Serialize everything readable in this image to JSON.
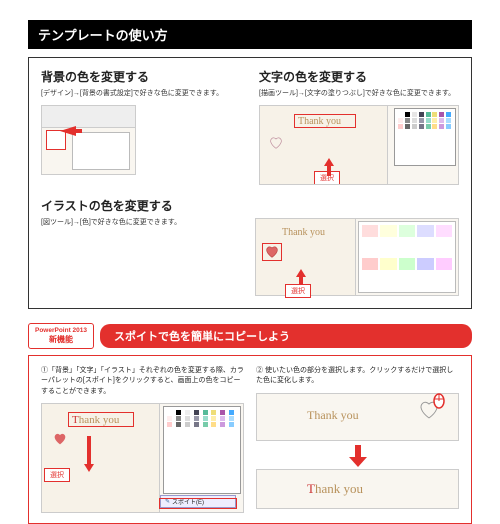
{
  "header": "テンプレートの使い方",
  "sec1": {
    "title": "背景の色を変更する",
    "desc": "[デザイン]→[背景の書式設定]で好きな色に変更できます。"
  },
  "sec2": {
    "title": "文字の色を変更する",
    "desc": "[描画ツール]→[文字の塗りつぶし]で好きな色に変更できます。",
    "thank": "Thank you",
    "select": "選択"
  },
  "sec3": {
    "title": "イラストの色を変更する",
    "desc": "[図ツール]→[色]で好きな色に変更できます。",
    "thank": "Thank you",
    "select": "選択"
  },
  "tip": {
    "badge1": "PowerPoint 2013",
    "badge2": "新機能",
    "pill": "スポイトで色を簡単にコピーしよう"
  },
  "step1": "①「背景」「文字」「イラスト」それぞれの色を変更する際、カラーパレットの[スポイト]をクリックすると、画面上の色をコピーすることができます。",
  "step2": "② 使いたい色の部分を選択します。クリックするだけで選択した色に変化します。",
  "thank": "Thank you",
  "select": "選択",
  "dropper": "スポイト(E)"
}
